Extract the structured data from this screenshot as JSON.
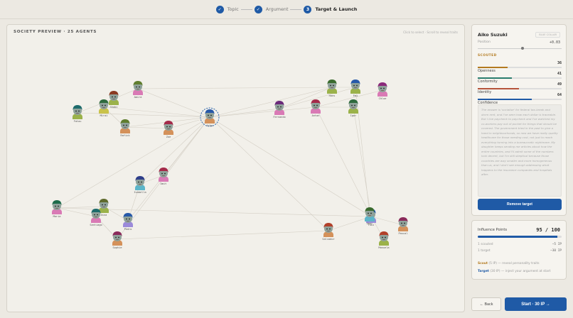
{
  "stepper": {
    "steps": [
      {
        "num": "✓",
        "label": "Topic"
      },
      {
        "num": "✓",
        "label": "Argument"
      },
      {
        "num": "3",
        "label": "Target & Launch"
      }
    ]
  },
  "graph": {
    "title": "SOCIETY PREVIEW · 25 AGENTS",
    "hint": "Click to select · Scroll to reveal traits"
  },
  "agents": [
    {
      "id": "a1",
      "name": "Amira",
      "hair": "#5f7d2e",
      "shirt": "#d97ab5"
    },
    {
      "id": "a2",
      "name": "Shabi",
      "hair": "#8a3a22",
      "shirt": "#9bb24a"
    },
    {
      "id": "a3",
      "name": "Mirai",
      "hair": "#2f6b3e",
      "shirt": "#c9c24a"
    },
    {
      "id": "a4",
      "name": "Fatou",
      "hair": "#1d6b6b",
      "shirt": "#9bb24a"
    },
    {
      "id": "a5",
      "name": "Rafick",
      "hair": "#5f7d2e",
      "shirt": "#d4915a"
    },
    {
      "id": "a6",
      "name": "Zoe",
      "hair": "#a42a4a",
      "shirt": "#d4915a"
    },
    {
      "id": "a7",
      "name": "Aiko",
      "hair": "#2759a8",
      "shirt": "#d4915a"
    },
    {
      "id": "a8",
      "name": "Fernando",
      "hair": "#6b2a7a",
      "shirt": "#d97ab5"
    },
    {
      "id": "a9",
      "name": "Anton",
      "hair": "#a42a4a",
      "shirt": "#d97ab5"
    },
    {
      "id": "a10",
      "name": "Hans",
      "hair": "#3a6b2e",
      "shirt": "#9bb24a"
    },
    {
      "id": "a11",
      "name": "Emi",
      "hair": "#2759a8",
      "shirt": "#9bb24a"
    },
    {
      "id": "a12",
      "name": "Igor",
      "hair": "#2f6b3e",
      "shirt": "#9bb24a"
    },
    {
      "id": "a13",
      "name": "Chloe",
      "hair": "#8a2a7a",
      "shirt": "#d97ab5"
    },
    {
      "id": "a14",
      "name": "Isabella",
      "hair": "#2e3e8a",
      "shirt": "#5cb5c9"
    },
    {
      "id": "a15",
      "name": "Amit",
      "hair": "#a42a4a",
      "shirt": "#d97ab5"
    },
    {
      "id": "a16",
      "name": "Maria",
      "hair": "#1d6b4a",
      "shirt": "#d97ab5"
    },
    {
      "id": "a17",
      "name": "Dina",
      "hair": "#5f6b2e",
      "shirt": "#9bb24a"
    },
    {
      "id": "a18",
      "name": "Santiago",
      "hair": "#1d6b6b",
      "shirt": "#d97ab5"
    },
    {
      "id": "a19",
      "name": "Pedro",
      "hair": "#2759a8",
      "shirt": "#9b8ad9"
    },
    {
      "id": "a20",
      "name": "Sophie",
      "hair": "#8a2a5a",
      "shirt": "#d4915a"
    },
    {
      "id": "a21",
      "name": "Salvador",
      "hair": "#b2402a",
      "shirt": "#d4915a"
    },
    {
      "id": "a22",
      "name": "Yuki",
      "hair": "#2759a8",
      "shirt": "#9b8ad9"
    },
    {
      "id": "a23",
      "name": "Manuela",
      "hair": "#b2402a",
      "shirt": "#9bb24a"
    },
    {
      "id": "a24",
      "name": "Pascal",
      "hair": "#8a2a5a",
      "shirt": "#d4915a"
    },
    {
      "id": "a25",
      "name": "Omar",
      "hair": "#3a6b2e",
      "shirt": "#5cb5c9"
    }
  ],
  "edges": [
    [
      "a7",
      "a1"
    ],
    [
      "a7",
      "a3"
    ],
    [
      "a7",
      "a4"
    ],
    [
      "a7",
      "a5"
    ],
    [
      "a7",
      "a6"
    ],
    [
      "a7",
      "a8"
    ],
    [
      "a7",
      "a9"
    ],
    [
      "a7",
      "a10"
    ],
    [
      "a7",
      "a14"
    ],
    [
      "a7",
      "a15"
    ],
    [
      "a7",
      "a16"
    ],
    [
      "a7",
      "a21"
    ],
    [
      "a7",
      "a22"
    ],
    [
      "a7",
      "a20"
    ],
    [
      "a7",
      "a19"
    ],
    [
      "a1",
      "a10"
    ],
    [
      "a1",
      "a2"
    ],
    [
      "a2",
      "a4"
    ],
    [
      "a3",
      "a5"
    ],
    [
      "a5",
      "a6"
    ],
    [
      "a8",
      "a10"
    ],
    [
      "a8",
      "a11"
    ],
    [
      "a9",
      "a12"
    ],
    [
      "a9",
      "a13"
    ],
    [
      "a10",
      "a11"
    ],
    [
      "a16",
      "a17"
    ],
    [
      "a16",
      "a18"
    ],
    [
      "a17",
      "a19"
    ],
    [
      "a18",
      "a20"
    ],
    [
      "a14",
      "a15"
    ],
    [
      "a14",
      "a19"
    ],
    [
      "a21",
      "a22"
    ],
    [
      "a22",
      "a23"
    ],
    [
      "a22",
      "a24"
    ],
    [
      "a12",
      "a22"
    ],
    [
      "a16",
      "a22"
    ],
    [
      "a20",
      "a21"
    ],
    [
      "a9",
      "a22"
    ],
    [
      "a11",
      "a25"
    ]
  ],
  "selected_agent": "a7",
  "detail": {
    "name": "Aiko Suzuki",
    "chip": "BLUE COLLAR",
    "position_label": "Position",
    "position_value": "+0.03",
    "position_fraction": 0.53,
    "scouted_label": "SCOUTED",
    "traits": [
      {
        "label": "Openness",
        "value": "36",
        "fraction": 0.36,
        "color": "#b37a1f"
      },
      {
        "label": "Conformity",
        "value": "41",
        "fraction": 0.41,
        "color": "#2a7d6e"
      },
      {
        "label": "Identity",
        "value": "49",
        "fraction": 0.49,
        "color": "#b5533a"
      },
      {
        "label": "Confidence",
        "value": "64",
        "fraction": 0.64,
        "color": "#1f5aa6"
      }
    ],
    "quote": "The answer is 'socialise' for federal tax-break and dorm rent, and I've seen how each dollar is traceable. But I live paycheck to paycheck and I've watched my co-workers pay out of pocket for things that should be covered. The government tried in the past to give a hand in neighbourhoods, so now we have really quality healthcare for those needing cost, not just to reach everything turning into a bureaucratic nightmare. My daughter keeps sending me articles about how the entire countries, and I'll admit some of the numbers look decent, but I'm still skeptical because those countries are way smaller and more homogeneous than us, and I don't see enough addressing what happens to the insurance companies and hospitals after.",
    "remove_label": "Remove target"
  },
  "influence": {
    "label": "Influence Points",
    "value": "95 / 100",
    "fraction": 0.95,
    "rows": [
      {
        "label": "1 scouted",
        "value": "−5 IP"
      },
      {
        "label": "1 target",
        "value": "−30 IP"
      }
    ],
    "legend": [
      {
        "key": "Scout",
        "cost": "(5 IP)",
        "desc": "— reveal personality traits"
      },
      {
        "key": "Target",
        "cost": "(30 IP)",
        "desc": "— inject your argument at start"
      }
    ]
  },
  "footer": {
    "back_label": "← Back",
    "start_label": "Start · 30 IP →"
  }
}
